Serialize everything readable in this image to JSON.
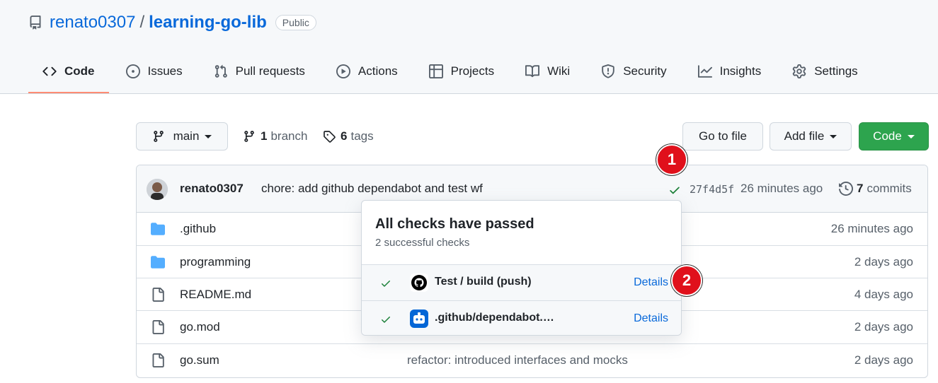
{
  "repo": {
    "owner": "renato0307",
    "separator": "/",
    "name": "learning-go-lib",
    "visibility": "Public"
  },
  "tabs": [
    {
      "label": "Code",
      "icon": "code-icon",
      "active": true
    },
    {
      "label": "Issues",
      "icon": "issue-opened-icon"
    },
    {
      "label": "Pull requests",
      "icon": "git-pull-request-icon"
    },
    {
      "label": "Actions",
      "icon": "play-icon"
    },
    {
      "label": "Projects",
      "icon": "table-icon"
    },
    {
      "label": "Wiki",
      "icon": "book-icon"
    },
    {
      "label": "Security",
      "icon": "shield-icon"
    },
    {
      "label": "Insights",
      "icon": "graph-icon"
    },
    {
      "label": "Settings",
      "icon": "gear-icon"
    }
  ],
  "toolbar": {
    "branch": "main",
    "branch_count": "1",
    "branch_label": "branch",
    "tag_count": "6",
    "tag_label": "tags",
    "go_to_file": "Go to file",
    "add_file": "Add file",
    "code": "Code"
  },
  "commit": {
    "author": "renato0307",
    "message": "chore: add github dependabot and test wf",
    "sha": "27f4d5f",
    "time": "26 minutes ago",
    "count": "7",
    "count_label": "commits"
  },
  "files": [
    {
      "type": "folder",
      "name": ".github",
      "message": "",
      "time": "26 minutes ago"
    },
    {
      "type": "folder",
      "name": "programming",
      "message": "",
      "time": "2 days ago"
    },
    {
      "type": "file",
      "name": "README.md",
      "message": "",
      "time": "4 days ago"
    },
    {
      "type": "file",
      "name": "go.mod",
      "message": "",
      "time": "2 days ago"
    },
    {
      "type": "file",
      "name": "go.sum",
      "message": "refactor: introduced interfaces and mocks",
      "time": "2 days ago"
    }
  ],
  "checks_popover": {
    "title": "All checks have passed",
    "subtitle": "2 successful checks",
    "checks": [
      {
        "name": "Test / build (push)",
        "app_icon": "github-icon",
        "link": "Details"
      },
      {
        "name": ".github/dependabot.…",
        "app_icon": "dependabot-icon",
        "link": "Details"
      }
    ]
  },
  "markers": [
    "1",
    "2"
  ],
  "colors": {
    "accent_blue": "#0969da",
    "success_green": "#1a7f37",
    "primary_button": "#2da44e",
    "tab_underline": "#fd8c73",
    "folder_blue": "#54aeff",
    "marker_red": "#e0101b"
  }
}
